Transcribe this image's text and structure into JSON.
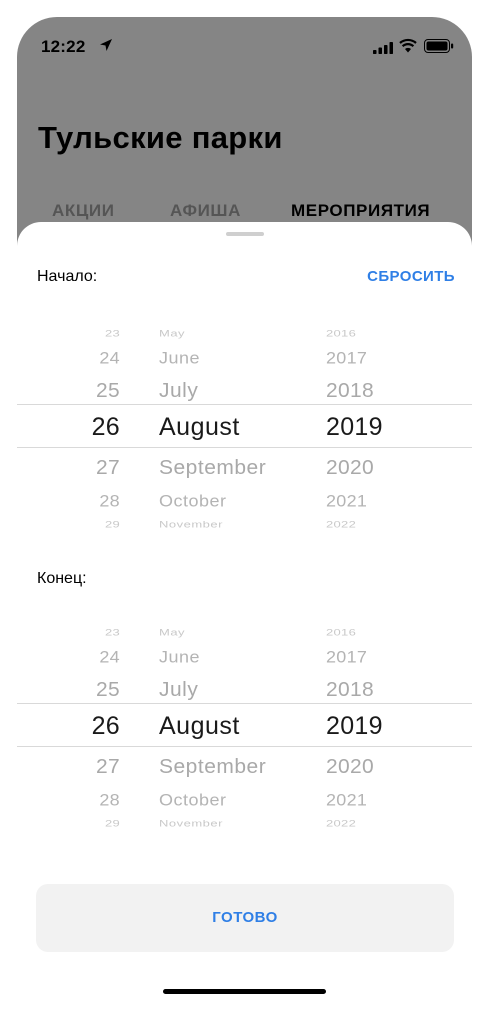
{
  "status_bar": {
    "time": "12:22"
  },
  "header": {
    "title": "Тульские парки",
    "tabs": [
      "АКЦИИ",
      "АФИША",
      "МЕРОПРИЯТИЯ"
    ]
  },
  "sheet": {
    "start_label": "Начало:",
    "reset_label": "СБРОСИТЬ",
    "end_label": "Конец:",
    "done_label": "ГОТОВО"
  },
  "start_picker": {
    "days": [
      "23",
      "24",
      "25",
      "26",
      "27",
      "28",
      "29"
    ],
    "months": [
      "May",
      "June",
      "July",
      "August",
      "September",
      "October",
      "November"
    ],
    "years": [
      "2016",
      "2017",
      "2018",
      "2019",
      "2020",
      "2021",
      "2022"
    ],
    "selected": {
      "day": "26",
      "month": "August",
      "year": "2019"
    }
  },
  "end_picker": {
    "days": [
      "23",
      "24",
      "25",
      "26",
      "27",
      "28",
      "29"
    ],
    "months": [
      "May",
      "June",
      "July",
      "August",
      "September",
      "October",
      "November"
    ],
    "years": [
      "2016",
      "2017",
      "2018",
      "2019",
      "2020",
      "2021",
      "2022"
    ],
    "selected": {
      "day": "26",
      "month": "August",
      "year": "2019"
    }
  },
  "colors": {
    "accent": "#2f7fe6",
    "dim_overlay": "#858585",
    "wheel_text": "#b7b7b7"
  }
}
